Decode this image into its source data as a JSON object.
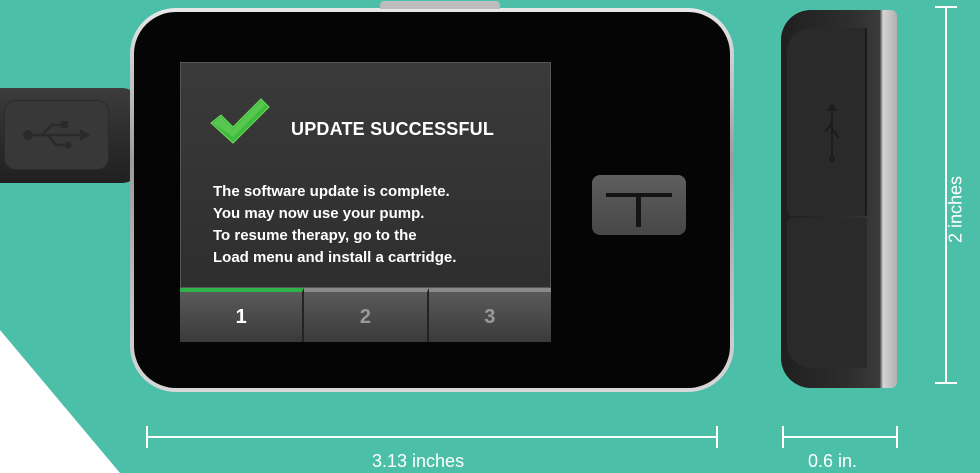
{
  "screen": {
    "title": "UPDATE SUCCESSFUL",
    "message_lines": [
      "The software update is complete.",
      "You may now use your pump.",
      "To resume therapy, go to the",
      "Load menu and install a cartridge."
    ],
    "tabs": [
      {
        "label": "1",
        "active": true
      },
      {
        "label": "2",
        "active": false
      },
      {
        "label": "3",
        "active": false
      }
    ]
  },
  "dimensions": {
    "width": "3.13 inches",
    "depth": "0.6 in.",
    "height": "2 inches"
  },
  "icons": {
    "check": "checkmark-icon",
    "usb": "usb-icon",
    "t_button": "t-logo-icon"
  },
  "colors": {
    "background": "#4cbfa8",
    "active_tab": "#2db34a",
    "check": "#3dbb3a"
  }
}
